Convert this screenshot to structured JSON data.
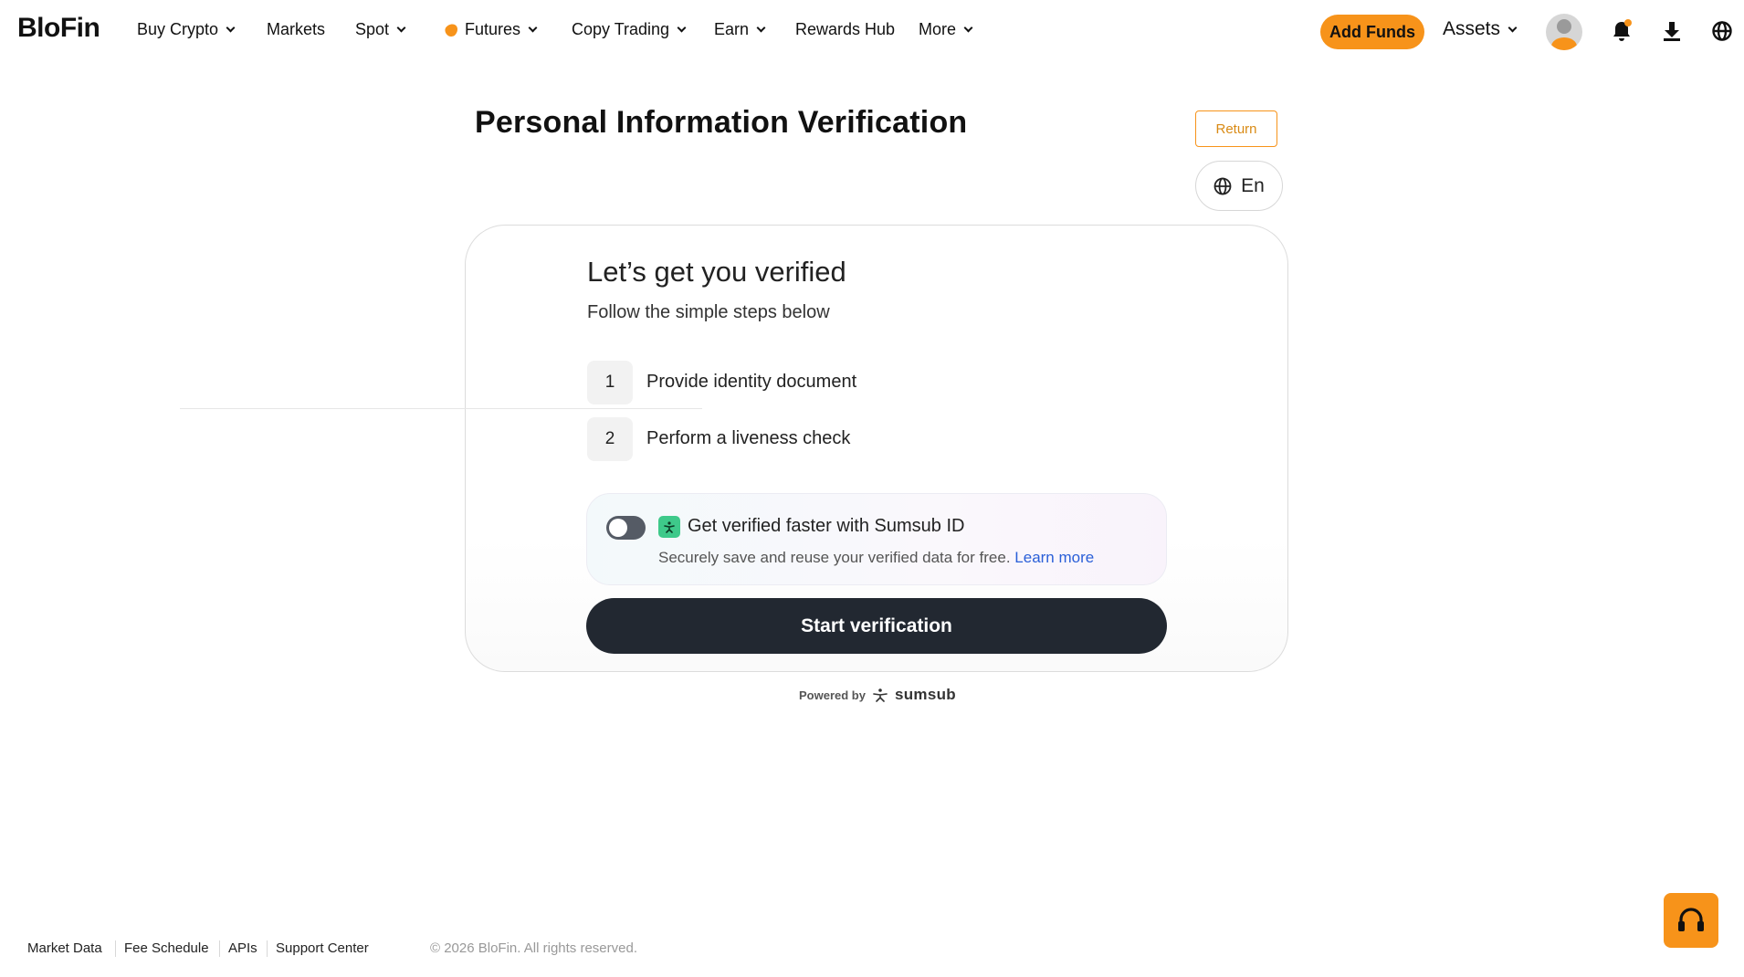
{
  "header": {
    "logo": "BloFin",
    "nav": [
      {
        "label": "Buy Crypto",
        "dropdown": true
      },
      {
        "label": "Markets",
        "dropdown": false
      },
      {
        "label": "Spot",
        "dropdown": true
      },
      {
        "label": "Futures",
        "dropdown": true,
        "icon": "fire-icon"
      },
      {
        "label": "Copy Trading",
        "dropdown": true
      },
      {
        "label": "Earn",
        "dropdown": true
      },
      {
        "label": "Rewards Hub",
        "dropdown": false
      },
      {
        "label": "More",
        "dropdown": true
      }
    ],
    "add_funds_label": "Add Funds",
    "assets_label": "Assets",
    "icons": [
      "avatar",
      "bell-icon",
      "download-icon",
      "globe-icon"
    ]
  },
  "page": {
    "title": "Personal Information Verification",
    "return_label": "Return",
    "language_label": "En"
  },
  "verification": {
    "heading": "Let’s get you verified",
    "subheading": "Follow the simple steps below",
    "steps": [
      {
        "number": "1",
        "label": "Provide identity document"
      },
      {
        "number": "2",
        "label": "Perform a liveness check"
      }
    ],
    "sumsub_id": {
      "title": "Get verified faster with Sumsub ID",
      "description": "Securely save and reuse your verified data for free.",
      "link_label": "Learn more",
      "toggle_on": false
    },
    "start_label": "Start verification",
    "powered_by": "Powered by",
    "powered_brand": "sumsub"
  },
  "footer": {
    "links": [
      "Market Data",
      "Fee Schedule",
      "APIs",
      "Support Center"
    ],
    "copyright": "© 2026 BloFin. All rights reserved."
  },
  "colors": {
    "accent": "#f7931a",
    "primary_button": "#222831",
    "link": "#2a5fd8",
    "sumsub_green": "#3ec98a"
  }
}
